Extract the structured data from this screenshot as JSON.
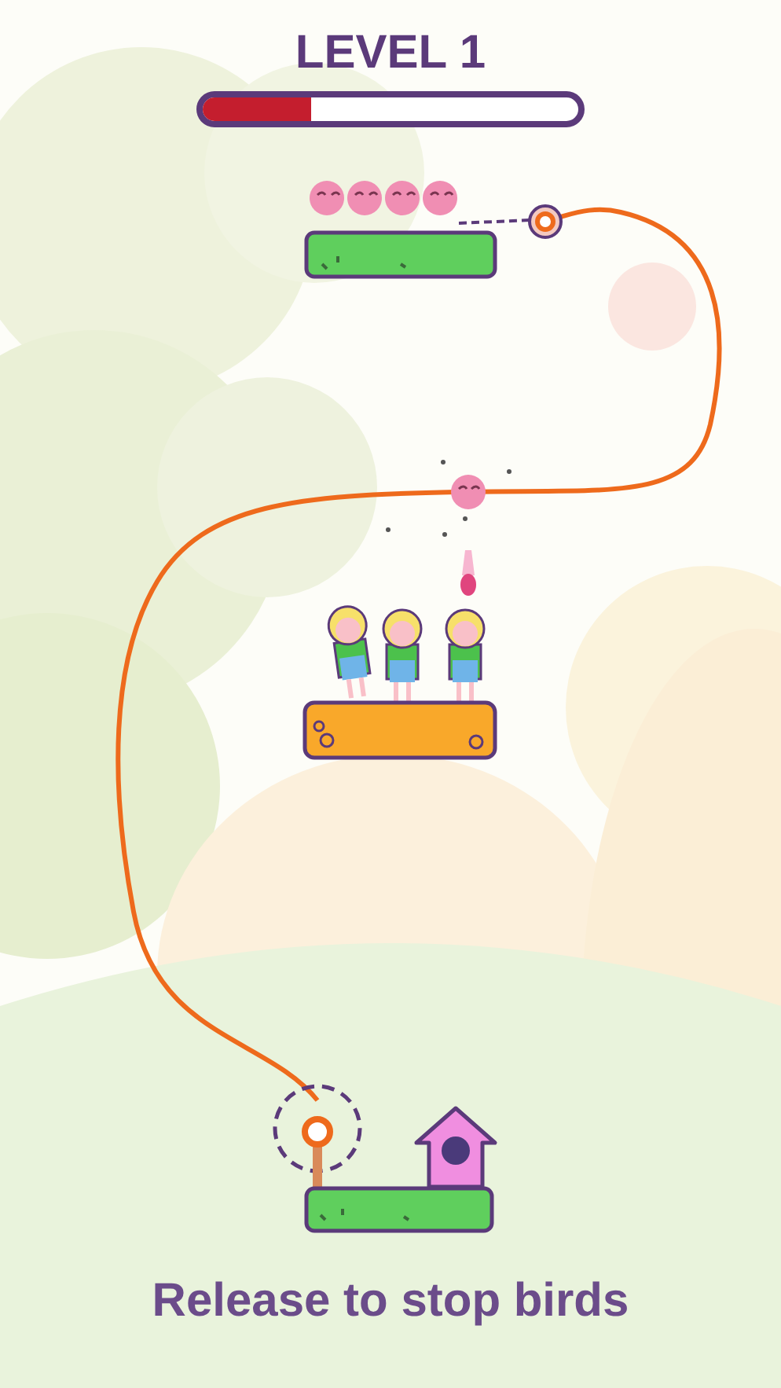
{
  "level_title": "LEVEL 1",
  "progress": {
    "level": 0.29
  },
  "hint": "Release to stop birds"
}
